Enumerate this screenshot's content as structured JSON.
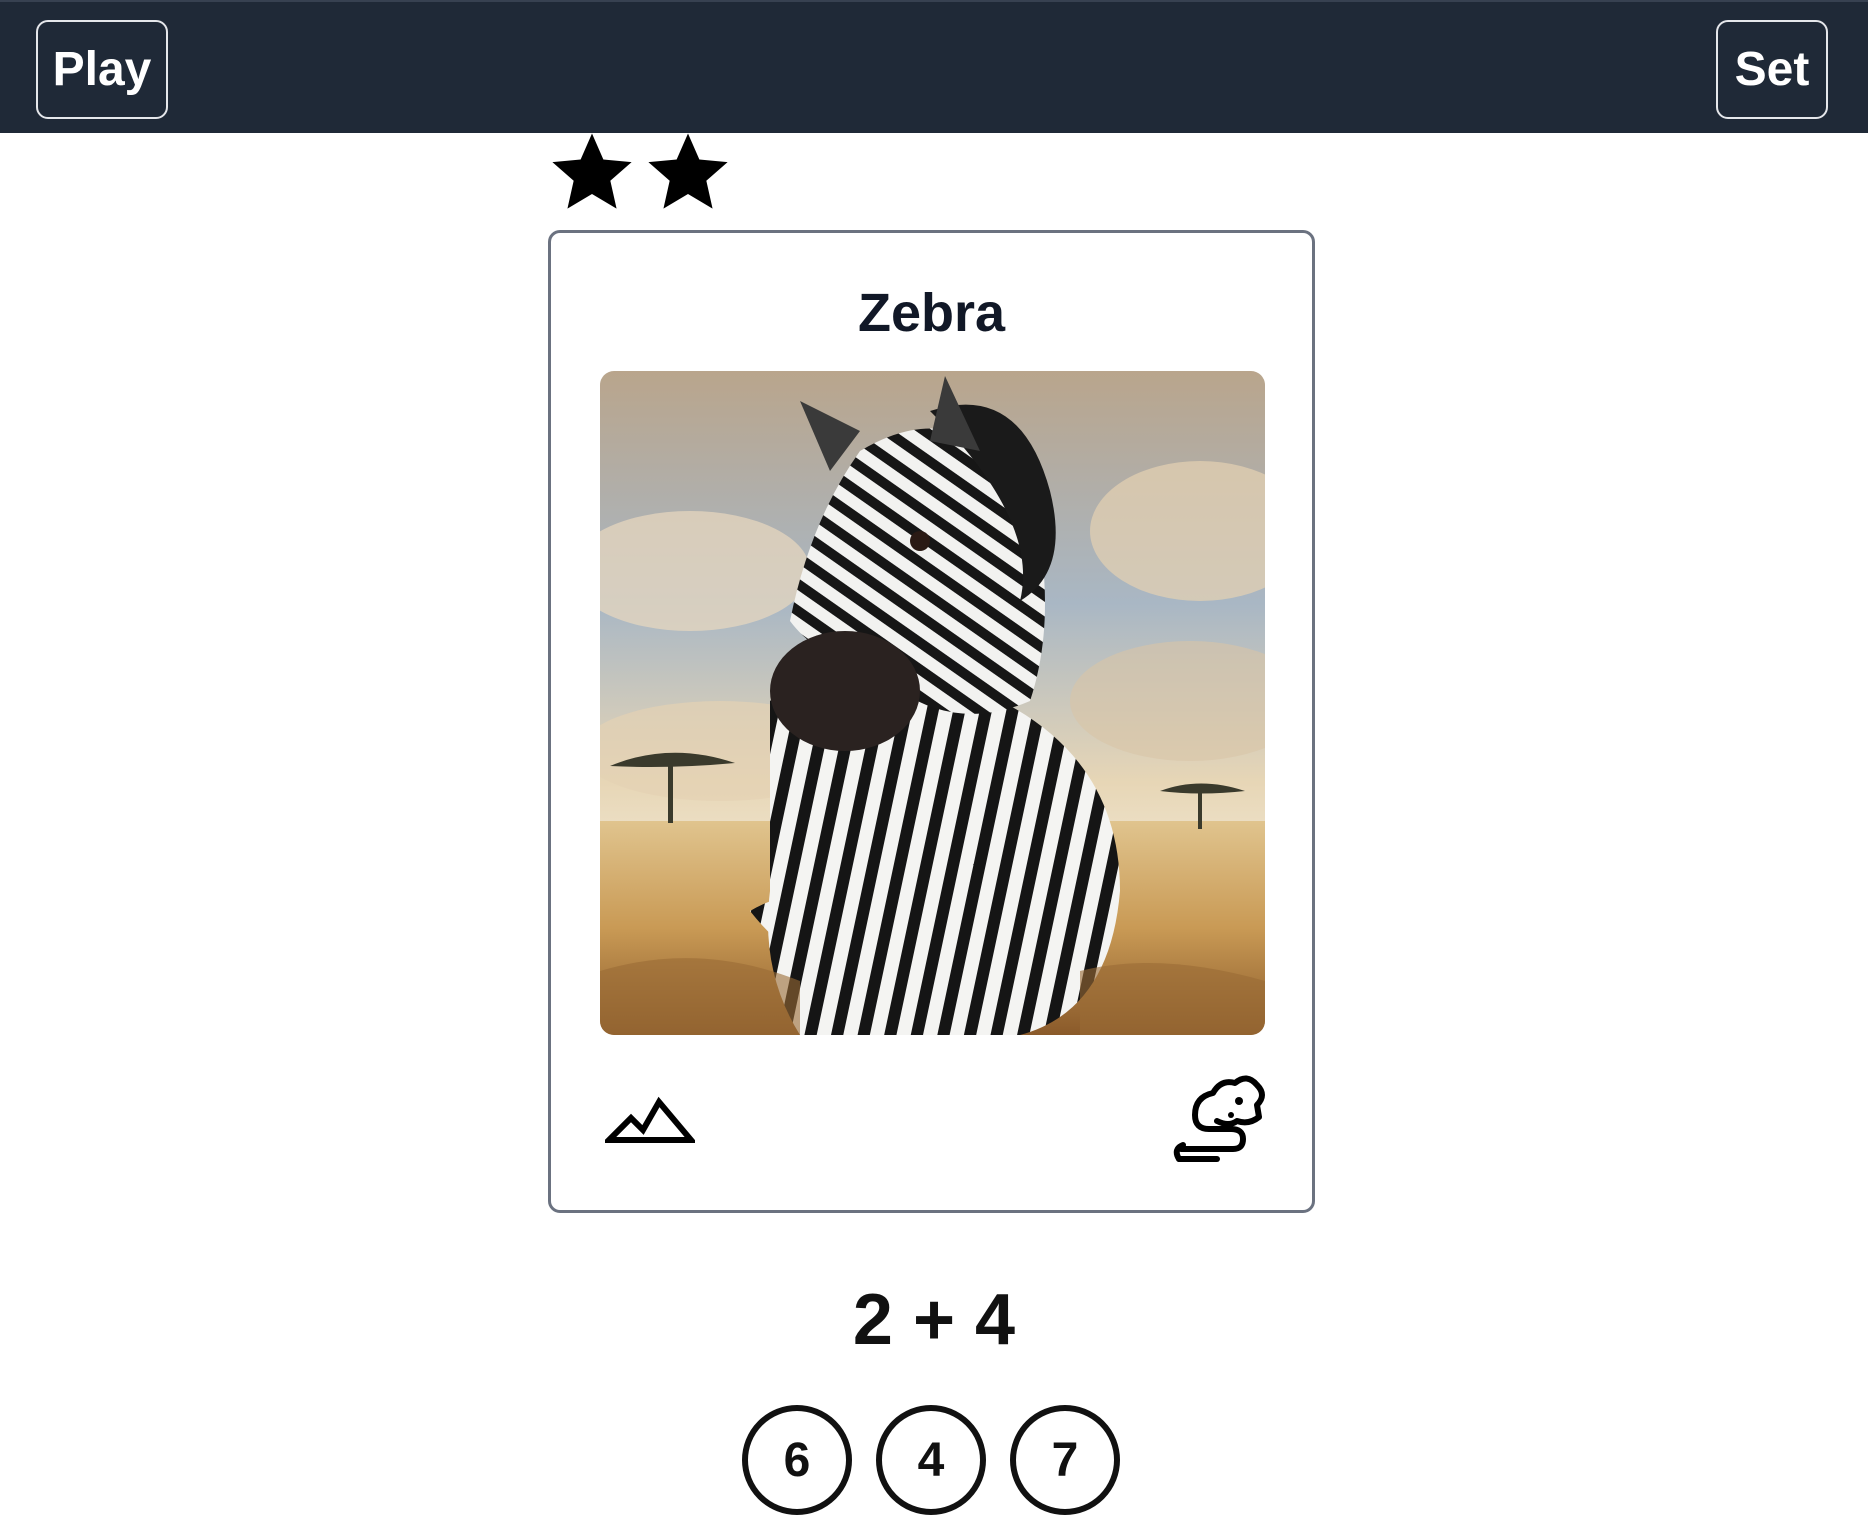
{
  "nav": {
    "play_label": "Play",
    "set_label": "Set"
  },
  "rating": {
    "stars": 2,
    "icon": "star-icon"
  },
  "card": {
    "title": "Zebra",
    "habitat_icon": "mountain-icon",
    "diet_icon": "rodent-icon"
  },
  "quiz": {
    "equation": "2 + 4",
    "options": [
      "6",
      "4",
      "7"
    ]
  },
  "colors": {
    "topbar": "#1f2937",
    "card_border": "#6b7280"
  }
}
